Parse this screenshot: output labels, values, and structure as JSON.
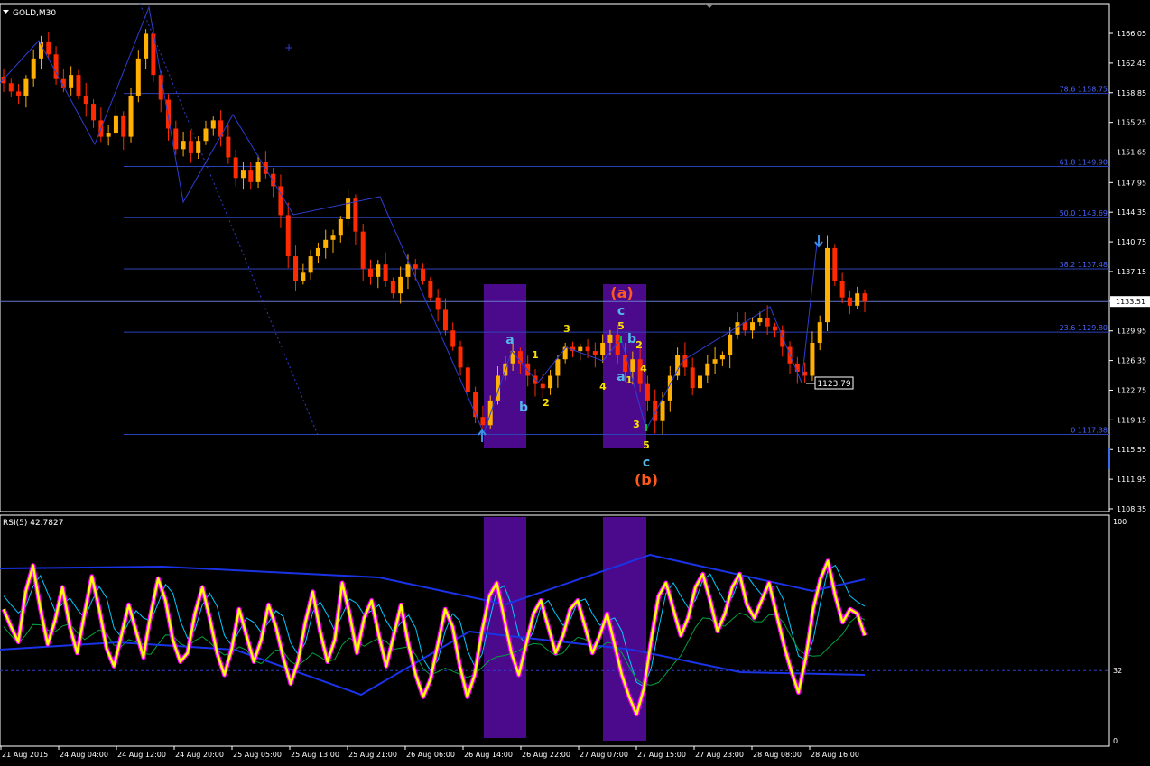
{
  "colors": {
    "background": "#000000",
    "frame": "#ffffff",
    "candle_up": "#ffb000",
    "candle_down": "#ff2a00",
    "fib_line": "#2c43b8",
    "fib_label": "#4a64ff",
    "zigzag": "#2d3ed0",
    "highlight_box": "#4b0a8c",
    "wave_yellow": "#ffe100",
    "wave_cyan": "#54b7e8",
    "wave_red": "#ff5a1e",
    "rsi_main": "#ffff00",
    "rsi_glow": "#ff00ff",
    "rsi_fast": "#00c8ff",
    "rsi_slow": "#00a040",
    "rsi_ma": "#1a33e6"
  },
  "chart_data": {
    "type": "candlestick",
    "title": "GOLD,M30",
    "ylim": [
      1108.35,
      1168.5
    ],
    "y_ticks": [
      "1166.05",
      "1162.45",
      "1158.85",
      "1155.25",
      "1151.65",
      "1147.95",
      "1144.35",
      "1140.75",
      "1137.15",
      "1133.55",
      "1129.95",
      "1126.35",
      "1122.75",
      "1119.15",
      "1115.55",
      "1111.95",
      "1108.35"
    ],
    "current_price": "1133.51",
    "x_ticks": [
      "21 Aug 2015",
      "24 Aug 04:00",
      "24 Aug 12:00",
      "24 Aug 20:00",
      "25 Aug 05:00",
      "25 Aug 13:00",
      "25 Aug 21:00",
      "26 Aug 06:00",
      "26 Aug 14:00",
      "26 Aug 22:00",
      "27 Aug 07:00",
      "27 Aug 15:00",
      "27 Aug 23:00",
      "28 Aug 08:00",
      "28 Aug 16:00"
    ],
    "closes": [
      1160.0,
      1159.0,
      1158.5,
      1160.5,
      1163.0,
      1165.0,
      1163.5,
      1160.5,
      1159.5,
      1161.0,
      1158.5,
      1157.5,
      1155.5,
      1153.5,
      1154.0,
      1156.0,
      1153.5,
      1158.5,
      1163.0,
      1166.0,
      1161.0,
      1158.0,
      1154.5,
      1152.0,
      1153.0,
      1151.5,
      1153.0,
      1154.5,
      1155.5,
      1153.5,
      1151.0,
      1148.5,
      1149.5,
      1148.0,
      1150.5,
      1149.0,
      1147.5,
      1144.0,
      1139.0,
      1136.0,
      1137.0,
      1139.0,
      1140.0,
      1141.0,
      1141.5,
      1143.5,
      1146.0,
      1142.0,
      1137.5,
      1136.5,
      1138.0,
      1136.0,
      1134.5,
      1136.5,
      1138.0,
      1137.5,
      1136.0,
      1134.0,
      1132.5,
      1130.0,
      1128.0,
      1125.5,
      1122.5,
      1119.5,
      1118.5,
      1121.5,
      1124.5,
      1126.0,
      1127.5,
      1126.0,
      1124.5,
      1123.5,
      1123.0,
      1124.5,
      1126.5,
      1128.0,
      1127.5,
      1128.0,
      1127.5,
      1127.0,
      1128.5,
      1129.5,
      1127.0,
      1125.0,
      1126.5,
      1123.5,
      1121.5,
      1119.0,
      1121.5,
      1124.5,
      1127.0,
      1125.5,
      1123.0,
      1124.5,
      1126.0,
      1126.5,
      1127.0,
      1129.5,
      1131.0,
      1130.0,
      1131.0,
      1131.5,
      1130.5,
      1130.0,
      1128.0,
      1126.0,
      1125.0,
      1124.5,
      1128.5,
      1131.0,
      1140.0,
      1136.0,
      1134.0,
      1133.0,
      1134.5,
      1133.5
    ],
    "fib_levels": [
      {
        "label": "78.6 1158.75",
        "value": 1158.75
      },
      {
        "label": "61.8 1149.90",
        "value": 1149.9
      },
      {
        "label": "50.0 1143.69",
        "value": 1143.69
      },
      {
        "label": "38.2 1137.48",
        "value": 1137.48
      },
      {
        "label": "23.6 1129.80",
        "value": 1129.8
      },
      {
        "label": "0 1117.38",
        "value": 1117.38
      }
    ],
    "price_tag": "1123.79",
    "wave_labels": {
      "a1": "a",
      "b1": "b",
      "y1": "1",
      "y2": "2",
      "y3": "3",
      "y4": "4",
      "y5": "5",
      "y1b": "1",
      "y2b": "2",
      "y3b": "3",
      "y4b": "4",
      "y5b": "5",
      "c1": "c",
      "b2": "b",
      "a2": "a",
      "c2": "c",
      "big_a": "(a)",
      "big_b": "(b)"
    },
    "rsi": {
      "title": "RSI(5) 42.7827",
      "ylim": [
        0,
        100
      ],
      "y_ticks": [
        "100",
        "32",
        "0"
      ],
      "level": 32,
      "values": [
        60,
        52,
        45,
        68,
        80,
        60,
        44,
        55,
        70,
        52,
        40,
        58,
        75,
        60,
        42,
        34,
        48,
        62,
        50,
        38,
        58,
        74,
        64,
        46,
        36,
        40,
        58,
        70,
        56,
        40,
        30,
        42,
        60,
        48,
        36,
        46,
        62,
        52,
        38,
        26,
        36,
        54,
        68,
        50,
        36,
        46,
        72,
        58,
        40,
        56,
        64,
        48,
        34,
        48,
        62,
        44,
        30,
        20,
        28,
        44,
        60,
        52,
        34,
        20,
        30,
        50,
        66,
        72,
        56,
        40,
        30,
        44,
        58,
        64,
        52,
        40,
        48,
        60,
        64,
        52,
        40,
        48,
        58,
        44,
        30,
        20,
        12,
        24,
        46,
        66,
        72,
        60,
        48,
        56,
        70,
        76,
        64,
        50,
        58,
        70,
        76,
        62,
        56,
        64,
        72,
        58,
        44,
        32,
        22,
        38,
        60,
        74,
        82,
        66,
        54,
        60,
        58,
        48
      ]
    }
  }
}
